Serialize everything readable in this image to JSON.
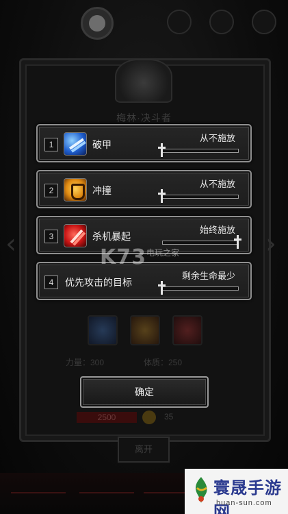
{
  "header": {
    "title": "梅林·决斗者"
  },
  "tactics": [
    {
      "index": "1",
      "name": "破甲",
      "setting": "从不施放",
      "slider_position": 0.0,
      "icon": "sword-slash-blue-icon",
      "icon_color": "#2f6fe0"
    },
    {
      "index": "2",
      "name": "冲撞",
      "setting": "从不施放",
      "slider_position": 0.0,
      "icon": "shield-charge-orange-icon",
      "icon_color": "#e08a12"
    },
    {
      "index": "3",
      "name": "杀机暴起",
      "setting": "始终施放",
      "slider_position": 1.0,
      "icon": "blade-strike-red-icon",
      "icon_color": "#c81414"
    },
    {
      "index": "4",
      "name": "优先攻击的目标",
      "setting": "剩余生命最少",
      "slider_position": 0.0,
      "icon": null,
      "icon_color": null
    }
  ],
  "watermark": {
    "brand": "K73",
    "sub": "电玩之家"
  },
  "stats": {
    "strength_label": "力量：300",
    "constitution_label": "体质：250"
  },
  "confirm_button": "确定",
  "footer_bar": {
    "value_left": "2500",
    "value_right": "35"
  },
  "leave_button": "离开",
  "logo": {
    "name": "寰晟手游网",
    "url_text": "huan-sun.com"
  },
  "colors": {
    "panel_border": "#8f8f8f",
    "background": "#0b0b0b",
    "text": "#f0f0f0"
  }
}
